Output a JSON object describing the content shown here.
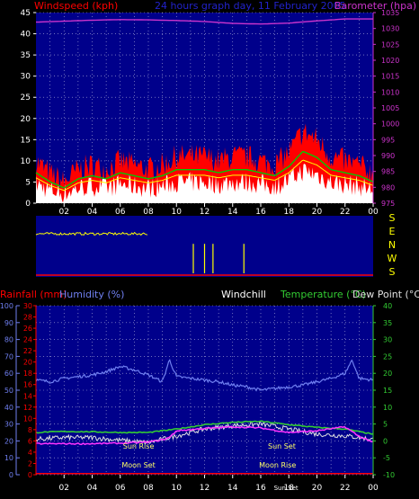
{
  "colors": {
    "background": "#000000",
    "plot_bg": "#00008b",
    "grid": "#ffffff",
    "wind_gust": "#ff0000",
    "wind_avg": "#ffffff",
    "wind_line": "#00cc00",
    "wind_line2": "#ffff00",
    "barometer": "#cc33cc",
    "direction": "#ffff00",
    "temperature": "#33cc33",
    "dewpoint": "#e0e0e0",
    "humidity": "#6f7ff0",
    "rainfall": "#ff0000",
    "sun_moon_label": "#ffff66",
    "moon_line": "#ff33ff"
  },
  "top_panel": {
    "left_axis_label": "Windspeed (kph)",
    "title": "24 hours graph day, 11 February 2005",
    "right_axis_label": "Barometer (hpa)"
  },
  "direction_panel": {
    "labels": [
      "S",
      "E",
      "N",
      "W",
      "S"
    ]
  },
  "bottom_panel": {
    "rainfall_label": "Rainfall (mm)",
    "humidity_label": "Humidity (%)",
    "windchill_label": "Windchill",
    "temperature_label": "Temperature (°C)",
    "dewpoint_label": "Dew Point (°C)",
    "annotations": {
      "sun_rise": "Sun Rise",
      "sun_set": "Sun Set",
      "moon_set": "Moon Set",
      "moon_rise": "Moon Rise",
      "sun_set_bottom": "Sun Set"
    }
  },
  "chart_data": [
    {
      "type": "line",
      "title": "24 hours graph day, 11 February 2005",
      "xlabel": "",
      "ylabel": "Windspeed (kph)",
      "y2label": "Barometer (hpa)",
      "x_ticks": [
        "02",
        "04",
        "06",
        "08",
        "10",
        "12",
        "14",
        "16",
        "18",
        "20",
        "22",
        "00"
      ],
      "ylim": [
        0,
        45
      ],
      "y_ticks": [
        0,
        5,
        10,
        15,
        20,
        25,
        30,
        35,
        40,
        45
      ],
      "y2lim": [
        975,
        1035
      ],
      "y2_ticks": [
        975,
        980,
        985,
        990,
        995,
        1000,
        1005,
        1010,
        1015,
        1020,
        1025,
        1030,
        1035
      ],
      "grid": true,
      "series": [
        {
          "name": "Windspeed (kph)",
          "axis": "left",
          "hours": [
            0,
            1,
            2,
            3,
            4,
            5,
            6,
            7,
            8,
            9,
            10,
            11,
            12,
            13,
            14,
            15,
            16,
            17,
            18,
            19,
            20,
            21,
            22,
            23,
            24
          ],
          "values": [
            10,
            7,
            5,
            8,
            9,
            8,
            10,
            9,
            8,
            9,
            11,
            11,
            11,
            10,
            11,
            11,
            10,
            9,
            12,
            17,
            15,
            11,
            10,
            9,
            7
          ]
        },
        {
          "name": "Barometer (hpa)",
          "axis": "right",
          "hours": [
            0,
            2,
            4,
            6,
            8,
            10,
            12,
            14,
            16,
            18,
            20,
            22,
            24
          ],
          "values": [
            1032,
            1032.3,
            1032.6,
            1032.8,
            1032.7,
            1032.5,
            1032.2,
            1031.6,
            1031.4,
            1031.7,
            1032.4,
            1033,
            1033
          ]
        }
      ]
    },
    {
      "type": "line",
      "title": "",
      "ylabel": "Wind direction",
      "x_ticks": [
        "02",
        "04",
        "06",
        "08",
        "10",
        "12",
        "14",
        "16",
        "18",
        "20",
        "22",
        "00"
      ],
      "y_ticks": [
        "S",
        "E",
        "N",
        "W",
        "S"
      ],
      "series": [
        {
          "name": "Direction",
          "hours": [
            0,
            2,
            4,
            6,
            8,
            9,
            10,
            12,
            14,
            16,
            17,
            18,
            20,
            22,
            24
          ],
          "values": [
            "W",
            "W",
            "W",
            "W",
            "W",
            "NW",
            "N",
            "N",
            "N",
            "N",
            "N",
            "W",
            "W",
            "W",
            "W"
          ]
        }
      ]
    },
    {
      "type": "line",
      "title": "",
      "x_ticks": [
        "02",
        "04",
        "06",
        "08",
        "10",
        "12",
        "14",
        "16",
        "18",
        "20",
        "22",
        "00"
      ],
      "humidity_ylim": [
        0,
        100
      ],
      "humidity_ticks": [
        0,
        10,
        20,
        30,
        40,
        50,
        60,
        70,
        80,
        90,
        100
      ],
      "rain_ylim": [
        0,
        30
      ],
      "rain_ticks": [
        0,
        2,
        4,
        6,
        8,
        10,
        12,
        14,
        16,
        18,
        20,
        22,
        24,
        26,
        28,
        30
      ],
      "temp_ylim": [
        -10,
        40
      ],
      "temp_ticks": [
        -10,
        -5,
        0,
        5,
        10,
        15,
        20,
        25,
        30,
        35,
        40
      ],
      "grid": true,
      "series": [
        {
          "name": "Humidity (%)",
          "axis": "humidity",
          "hours": [
            0,
            1,
            2,
            3,
            4,
            5,
            6,
            7,
            8,
            9,
            9.5,
            10,
            11,
            12,
            13,
            14,
            15,
            16,
            17,
            18,
            19,
            20,
            21,
            22,
            22.5,
            23,
            24
          ],
          "values": [
            56,
            55,
            57,
            58,
            59,
            61,
            64,
            62,
            59,
            55,
            68,
            58,
            57,
            56,
            55,
            53,
            52,
            50,
            51,
            52,
            53,
            55,
            57,
            60,
            68,
            57,
            56
          ]
        },
        {
          "name": "Temperature (°C)",
          "axis": "temp",
          "hours": [
            0,
            2,
            4,
            6,
            8,
            10,
            12,
            14,
            16,
            18,
            20,
            22,
            24
          ],
          "values": [
            2.5,
            2.8,
            2.7,
            2.5,
            2.5,
            3.5,
            4.8,
            5.5,
            5.8,
            4.8,
            4.0,
            3.5,
            2
          ]
        },
        {
          "name": "Dew Point (°C)",
          "axis": "temp",
          "hours": [
            0,
            2,
            4,
            6,
            8,
            10,
            12,
            14,
            16,
            18,
            20,
            22,
            24
          ],
          "values": [
            0.5,
            1,
            1,
            0.2,
            -0.5,
            1.5,
            3.5,
            4.5,
            5,
            3.5,
            2,
            1.5,
            0.5
          ]
        },
        {
          "name": "Rainfall (mm)",
          "axis": "rain",
          "hours": [
            0,
            2,
            4,
            6,
            8,
            9,
            9.5,
            10,
            12,
            14,
            16,
            18,
            20,
            22,
            23,
            24
          ],
          "values": [
            5.5,
            5.5,
            5.5,
            5.6,
            5.8,
            6.2,
            6.6,
            7.8,
            8.2,
            8.5,
            8.3,
            7.5,
            7.8,
            8.5,
            6.8,
            5.8
          ]
        },
        {
          "name": "Rainfall total",
          "axis": "rain",
          "hours": [
            0,
            24
          ],
          "values": [
            0.2,
            0.2
          ]
        }
      ],
      "annotations": [
        {
          "text": "Sun Rise",
          "hour": 7.3
        },
        {
          "text": "Moon Set",
          "hour": 7.3
        },
        {
          "text": "Sun Set",
          "hour": 17.5
        },
        {
          "text": "Moon Rise",
          "hour": 17.2
        }
      ]
    }
  ]
}
